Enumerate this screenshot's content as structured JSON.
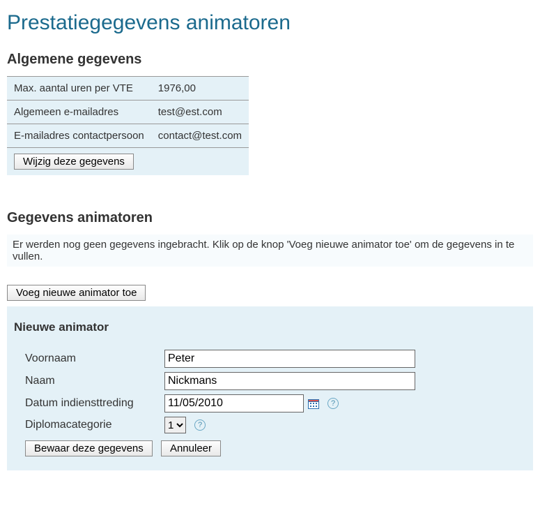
{
  "page_title": "Prestatiegegevens animatoren",
  "sections": {
    "general_heading": "Algemene gegevens",
    "animators_heading": "Gegevens animatoren",
    "new_animator_heading": "Nieuwe animator"
  },
  "general": {
    "rows": [
      {
        "label": "Max. aantal uren per VTE",
        "value": "1976,00"
      },
      {
        "label": "Algemeen e-mailadres",
        "value": "test@est.com"
      },
      {
        "label": "E-mailadres contactpersoon",
        "value": "contact@test.com"
      }
    ],
    "edit_button": "Wijzig deze gegevens"
  },
  "animators": {
    "empty_notice": "Er werden nog geen gegevens ingebracht. Klik op de knop 'Voeg nieuwe animator toe' om de gegevens in te vullen.",
    "add_button": "Voeg nieuwe animator toe"
  },
  "form": {
    "firstname_label": "Voornaam",
    "firstname_value": "Peter",
    "lastname_label": "Naam",
    "lastname_value": "Nickmans",
    "date_label": "Datum indiensttreding",
    "date_value": "11/05/2010",
    "diploma_label": "Diplomacategorie",
    "diploma_value": "1",
    "diploma_options": [
      "1"
    ],
    "save_button": "Bewaar deze gegevens",
    "cancel_button": "Annuleer"
  }
}
